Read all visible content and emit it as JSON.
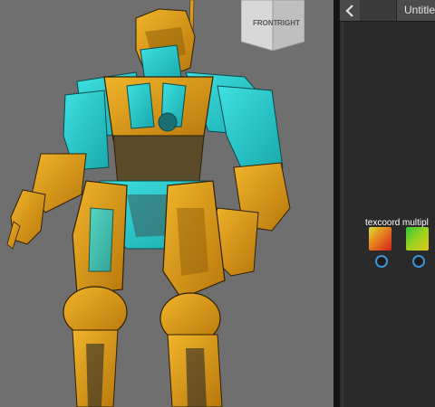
{
  "viewport": {
    "viewcube": {
      "front_label": "FRONT",
      "right_label": "RIGHT"
    },
    "colors": {
      "background": "#6f6f6f",
      "gold": "#d79a1c",
      "cyan": "#22c8cc"
    }
  },
  "panel": {
    "back_icon": "chevron-left-icon",
    "tab_title": "Untitle",
    "nodes": [
      {
        "label": "texcoord",
        "swatch": "red-green gradient"
      },
      {
        "label": "multipl",
        "swatch": "green-yellow gradient"
      }
    ]
  }
}
